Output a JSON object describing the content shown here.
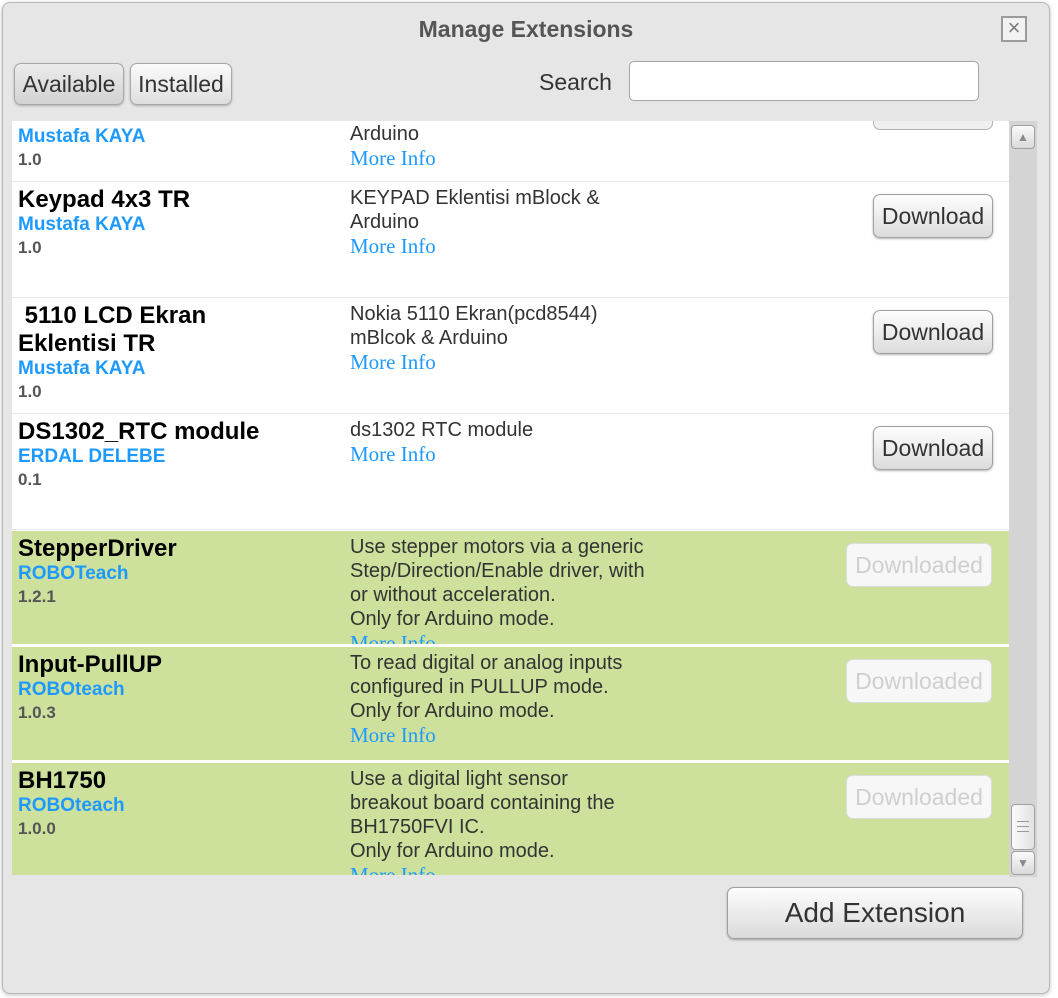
{
  "dialog": {
    "title": "Manage Extensions",
    "close_glyph": "×",
    "close_icon": "close-icon"
  },
  "tabs": {
    "available": "Available",
    "installed": "Installed"
  },
  "search": {
    "label": "Search",
    "value": "",
    "placeholder": ""
  },
  "top_partial": {
    "author": "Mustafa KAYA",
    "version": "1.0",
    "desc": "Arduino",
    "more": "More Info"
  },
  "extensions": [
    {
      "name": "Keypad 4x3 TR",
      "author": "Mustafa KAYA",
      "version": "1.0",
      "description": "KEYPAD Eklentisi mBlock & Arduino",
      "more": "More Info",
      "action": "Download"
    },
    {
      "name": " 5110 LCD Ekran Eklentisi TR",
      "author": "Mustafa KAYA",
      "version": "1.0",
      "description": "Nokia 5110 Ekran(pcd8544) mBlcok & Arduino",
      "more": "More Info",
      "action": "Download"
    },
    {
      "name": "DS1302_RTC module",
      "author": "ERDAL DELEBE",
      "version": "0.1",
      "description": "ds1302 RTC module",
      "more": "More Info",
      "action": "Download"
    },
    {
      "name": "StepperDriver",
      "author": "ROBOTeach",
      "version": "1.2.1",
      "description": "Use stepper motors via a generic Step/Direction/Enable driver, with or without acceleration.",
      "note": "Only for Arduino mode.",
      "more": "More Info",
      "action": "Downloaded"
    },
    {
      "name": "Input-PullUP",
      "author": "ROBOteach",
      "version": "1.0.3",
      "description": "To read digital or analog inputs configured in PULLUP mode.",
      "note": "Only for Arduino mode.",
      "more": "More Info",
      "action": "Downloaded"
    },
    {
      "name": "BH1750",
      "author": "ROBOteach",
      "version": "1.0.0",
      "description": "Use a digital light sensor breakout board containing the BH1750FVI IC.",
      "note": "Only for Arduino mode.",
      "more": "More Info",
      "action": "Downloaded"
    }
  ],
  "scrollbar": {
    "up_glyph": "▲",
    "down_glyph": "▼"
  },
  "footer": {
    "add_label": "Add Extension"
  },
  "colors": {
    "downloaded_row": "#cde19c",
    "link": "#1e9aff",
    "dialog_bg": "#e6e6e6"
  }
}
